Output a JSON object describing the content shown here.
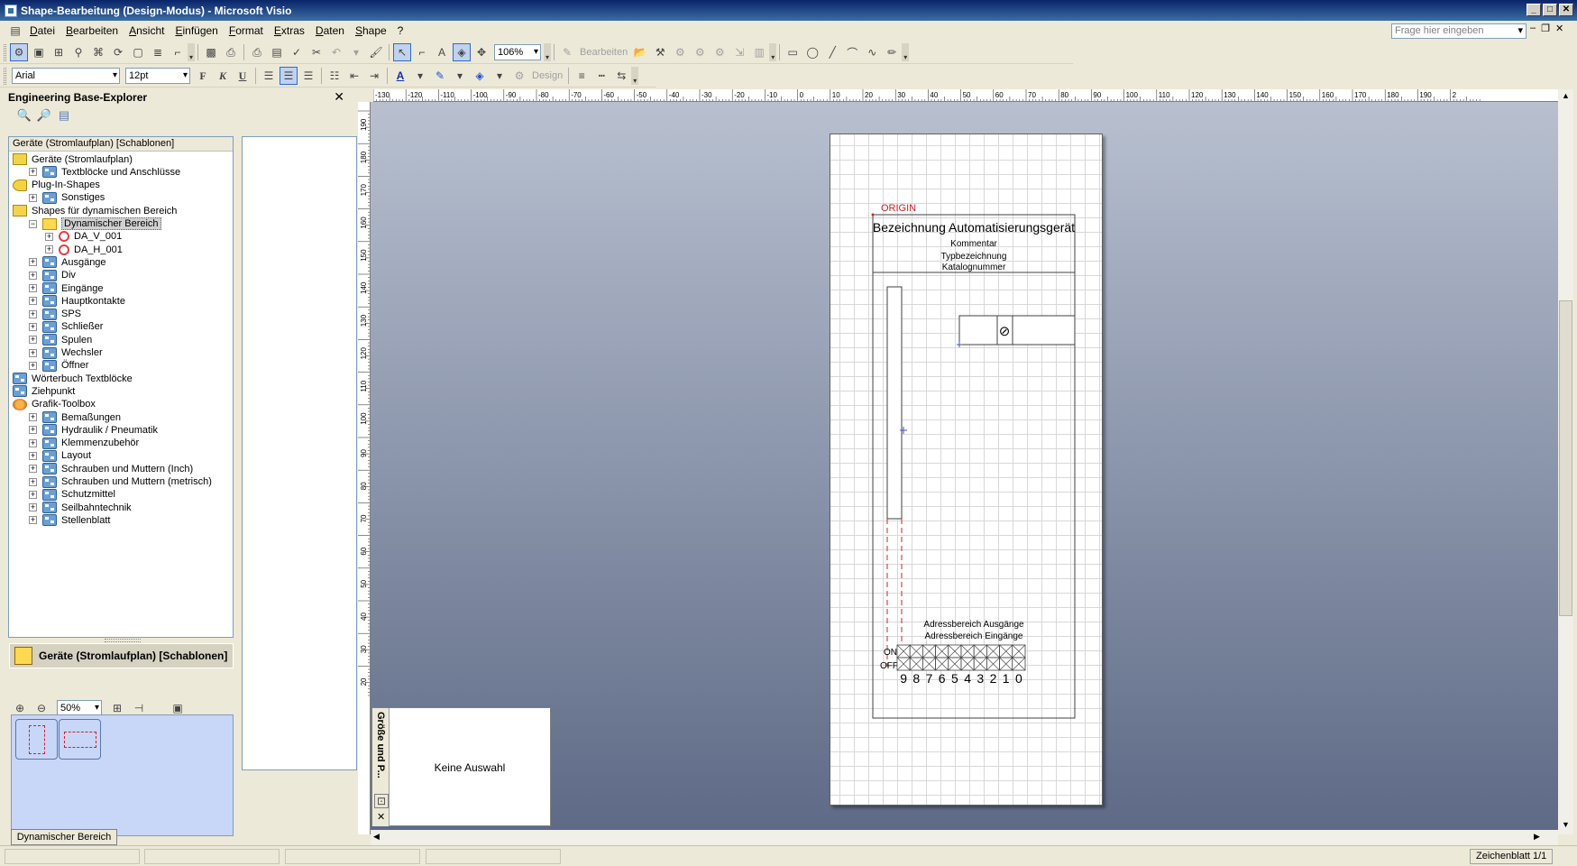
{
  "window": {
    "title": "Shape-Bearbeitung (Design-Modus) - Microsoft Visio"
  },
  "menu": [
    "Datei",
    "Bearbeiten",
    "Ansicht",
    "Einfügen",
    "Format",
    "Extras",
    "Daten",
    "Shape",
    "?"
  ],
  "ask": {
    "placeholder": "Frage hier eingeben"
  },
  "toolbar1": {
    "zoom": "106%",
    "edit_label": "Bearbeiten"
  },
  "toolbar2": {
    "font": "Arial",
    "size": "12pt",
    "design_label": "Design",
    "bold": "F",
    "italic": "K",
    "underline": "U"
  },
  "explorer": {
    "title": "Engineering Base-Explorer",
    "header": "Geräte (Stromlaufplan) [Schablonen]",
    "tree": [
      {
        "label": "Geräte (Stromlaufplan)",
        "level": 0,
        "icon": "folder",
        "expander": ""
      },
      {
        "label": "Textblöcke und Anschlüsse",
        "level": 1,
        "icon": "stencil",
        "expander": "+"
      },
      {
        "label": "Plug-In-Shapes",
        "level": 0,
        "icon": "plug",
        "expander": ""
      },
      {
        "label": "Sonstiges",
        "level": 1,
        "icon": "stencil",
        "expander": "+"
      },
      {
        "label": "Shapes für dynamischen Bereich",
        "level": 0,
        "icon": "folder",
        "expander": ""
      },
      {
        "label": "Dynamischer Bereich",
        "level": 1,
        "icon": "sel",
        "expander": "−",
        "selected": true
      },
      {
        "label": "DA_V_001",
        "level": 2,
        "icon": "shape",
        "expander": "+"
      },
      {
        "label": "DA_H_001",
        "level": 2,
        "icon": "shape",
        "expander": "+"
      },
      {
        "label": "Ausgänge",
        "level": 1,
        "icon": "stencil",
        "expander": "+"
      },
      {
        "label": "Div",
        "level": 1,
        "icon": "stencil",
        "expander": "+"
      },
      {
        "label": "Eingänge",
        "level": 1,
        "icon": "stencil",
        "expander": "+"
      },
      {
        "label": "Hauptkontakte",
        "level": 1,
        "icon": "stencil",
        "expander": "+"
      },
      {
        "label": "SPS",
        "level": 1,
        "icon": "stencil",
        "expander": "+"
      },
      {
        "label": "Schließer",
        "level": 1,
        "icon": "stencil",
        "expander": "+"
      },
      {
        "label": "Spulen",
        "level": 1,
        "icon": "stencil",
        "expander": "+"
      },
      {
        "label": "Wechsler",
        "level": 1,
        "icon": "stencil",
        "expander": "+"
      },
      {
        "label": "Öffner",
        "level": 1,
        "icon": "stencil",
        "expander": "+"
      },
      {
        "label": "Wörterbuch Textblöcke",
        "level": 0,
        "icon": "stencil",
        "expander": ""
      },
      {
        "label": "Ziehpunkt",
        "level": 0,
        "icon": "stencil",
        "expander": ""
      },
      {
        "label": "Grafik-Toolbox",
        "level": 0,
        "icon": "tool",
        "expander": ""
      },
      {
        "label": "Bemaßungen",
        "level": 1,
        "icon": "stencil",
        "expander": "+"
      },
      {
        "label": "Hydraulik / Pneumatik",
        "level": 1,
        "icon": "stencil",
        "expander": "+"
      },
      {
        "label": "Klemmenzubehör",
        "level": 1,
        "icon": "stencil",
        "expander": "+"
      },
      {
        "label": "Layout",
        "level": 1,
        "icon": "stencil",
        "expander": "+"
      },
      {
        "label": "Schrauben und Muttern (Inch)",
        "level": 1,
        "icon": "stencil",
        "expander": "+"
      },
      {
        "label": "Schrauben und Muttern (metrisch)",
        "level": 1,
        "icon": "stencil",
        "expander": "+"
      },
      {
        "label": "Schutzmittel",
        "level": 1,
        "icon": "stencil",
        "expander": "+"
      },
      {
        "label": "Seilbahntechnik",
        "level": 1,
        "icon": "stencil",
        "expander": "+"
      },
      {
        "label": "Stellenblatt",
        "level": 1,
        "icon": "stencil",
        "expander": "+"
      }
    ]
  },
  "stencil": {
    "title": "Geräte (Stromlaufplan) [Schablonen]",
    "zoom": "50%",
    "tab": "Dynamischer Bereich"
  },
  "ruler": {
    "top": [
      "-130",
      "-120",
      "-110",
      "-100",
      "-90",
      "-80",
      "-70",
      "-60",
      "-50",
      "-40",
      "-30",
      "-20",
      "-10",
      "0",
      "10",
      "20",
      "30",
      "40",
      "50",
      "60",
      "70",
      "80",
      "90",
      "100",
      "110",
      "120",
      "130",
      "140",
      "150",
      "160",
      "170",
      "180",
      "190",
      "2"
    ],
    "left": [
      "190",
      "180",
      "170",
      "160",
      "150",
      "140",
      "130",
      "120",
      "110",
      "100",
      "90",
      "80",
      "70",
      "60",
      "50",
      "40",
      "30",
      "20"
    ]
  },
  "sizepanel": {
    "title": "Größe und P...",
    "message": "Keine Auswahl"
  },
  "drawing": {
    "origin": "ORIGIN",
    "device_name": "Bezeichnung Automatisierungsgerät",
    "comment": "Kommentar",
    "type": "Typbezeichnung",
    "catalog": "Katalognummer",
    "addr_out": "Adressbereich Ausgänge",
    "addr_in": "Adressbereich Eingänge",
    "on": "ON",
    "off": "OFF",
    "digits": [
      "9",
      "8",
      "7",
      "6",
      "5",
      "4",
      "3",
      "2",
      "1",
      "0"
    ],
    "symbol": "⊘"
  },
  "status": {
    "page": "Zeichenblatt 1/1"
  }
}
